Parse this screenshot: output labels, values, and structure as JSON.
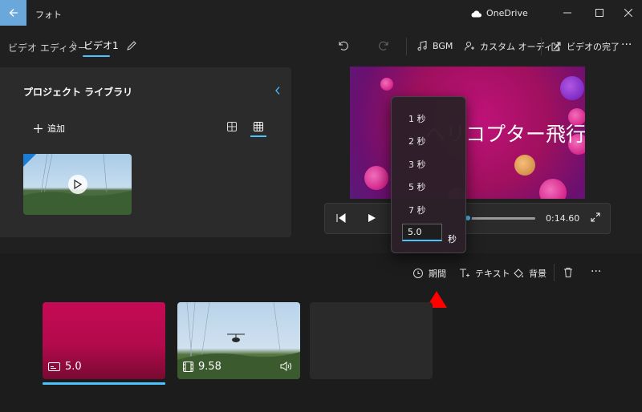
{
  "app": {
    "title": "フォト",
    "cloud_label": "OneDrive"
  },
  "breadcrumb": {
    "root": "ビデオ エディター",
    "current": "ビデオ1"
  },
  "toolbar": {
    "bgm_label": "BGM",
    "custom_audio_label": "カスタム オーディオ",
    "finish_label": "ビデオの完了"
  },
  "library": {
    "title": "プロジェクト ライブラリ",
    "add_label": "追加"
  },
  "preview": {
    "title": "ヘリコプター飛行",
    "time": "0:14.60"
  },
  "duration_menu": {
    "options": [
      "1 秒",
      "2 秒",
      "3 秒",
      "5 秒",
      "7 秒"
    ],
    "custom_value": "5.0",
    "unit": "秒"
  },
  "storyboard_toolbar": {
    "duration_label": "期間",
    "text_label": "テキスト",
    "background_label": "背景"
  },
  "clips": [
    {
      "duration": "5.0",
      "type_icon": "title-card-icon"
    },
    {
      "duration": "9.58",
      "type_icon": "film-icon"
    }
  ],
  "colors": {
    "accent": "#4cc2ff",
    "title_card": "#c50a55",
    "marker": "#ff0000"
  }
}
